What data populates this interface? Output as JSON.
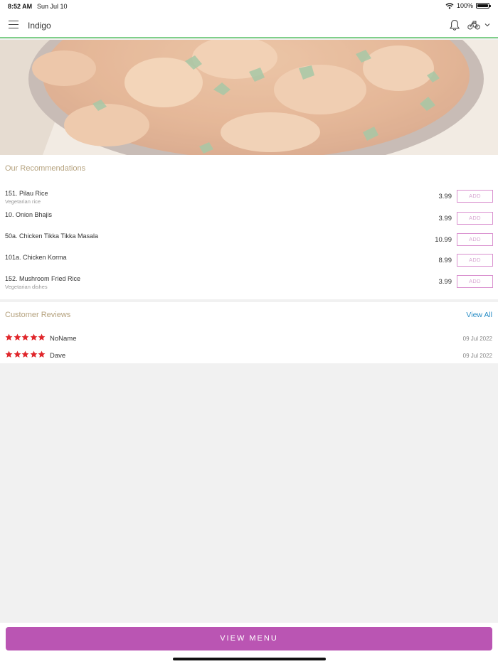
{
  "status_bar": {
    "time": "8:52 AM",
    "date": "Sun Jul 10",
    "battery": "100%",
    "battery_level": 1.0
  },
  "header": {
    "title": "Indigo",
    "icons": [
      "menu-icon",
      "bell-icon",
      "bike-icon",
      "chevron-down-icon"
    ]
  },
  "hero": {
    "icon": "curry-photo"
  },
  "recommendations": {
    "title": "Our Recommendations",
    "add_label": "ADD",
    "items": [
      {
        "name": "151. Pilau Rice",
        "desc": "Vegetarian rice",
        "price": "3.99"
      },
      {
        "name": "10. Onion Bhajis",
        "desc": "",
        "price": "3.99"
      },
      {
        "name": "50a. Chicken Tikka Tikka Masala",
        "desc": "",
        "price": "10.99"
      },
      {
        "name": "101a. Chicken Korma",
        "desc": "",
        "price": "8.99"
      },
      {
        "name": "152. Mushroom Fried Rice",
        "desc": "Vegetarian dishes",
        "price": "3.99"
      }
    ]
  },
  "reviews": {
    "title": "Customer Reviews",
    "view_all": "View All",
    "items": [
      {
        "name": "NoName",
        "date": "09 Jul 2022",
        "rating": 5
      },
      {
        "name": "Dave",
        "date": "09 Jul 2022",
        "rating": 5
      }
    ]
  },
  "footer": {
    "button": "VIEW MENU"
  },
  "colors": {
    "accent": "#ba55b3",
    "link": "#2a8ec6",
    "section_title": "#b5a27e",
    "star": "#e0262b",
    "header_border": "#7fcf8a"
  }
}
